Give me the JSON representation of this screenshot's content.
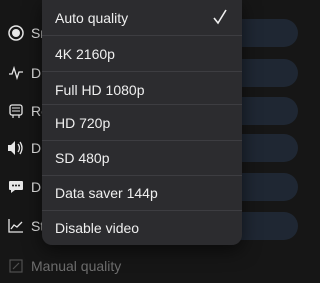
{
  "background_rows": [
    {
      "label": "Sn",
      "icon": "radio-selected-icon"
    },
    {
      "label": "Di",
      "icon": "waveform-icon"
    },
    {
      "label": "Re",
      "icon": "projector-icon"
    },
    {
      "label": "D",
      "icon": "speaker-icon"
    },
    {
      "label": "Di",
      "icon": "chat-bubble-icon"
    },
    {
      "label": "St",
      "icon": "stats-chart-icon"
    }
  ],
  "manual_quality": {
    "label": "Manual quality",
    "icon": "edit-icon"
  },
  "menu": {
    "items": [
      {
        "label": "Auto quality",
        "selected": true
      },
      {
        "label": "4K 2160p",
        "selected": false
      },
      {
        "label": "Full HD 1080p",
        "selected": false
      },
      {
        "label": "HD 720p",
        "selected": false
      },
      {
        "label": "SD 480p",
        "selected": false
      },
      {
        "label": "Data saver 144p",
        "selected": false
      },
      {
        "label": "Disable video",
        "selected": false
      }
    ]
  },
  "colors": {
    "background": "#161616",
    "menu_background": "#2c2c2f",
    "menu_text": "#efefef",
    "divider": "#3d3d41",
    "pill": "#1f2733"
  }
}
